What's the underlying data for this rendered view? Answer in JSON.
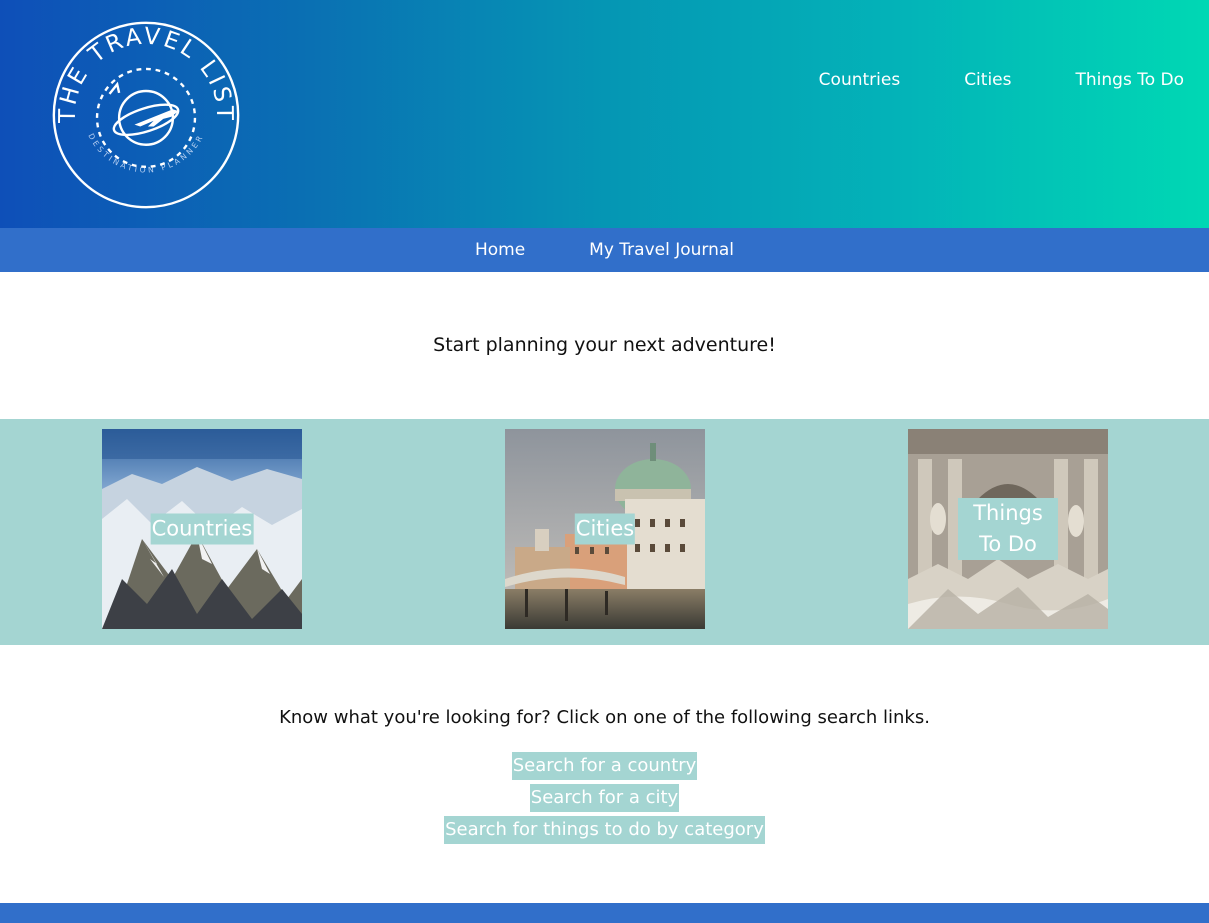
{
  "logo": {
    "top_text": "THE TRAVEL LIST",
    "bottom_text": "DESTINATION PLANNER"
  },
  "top_nav": [
    {
      "label": "Countries"
    },
    {
      "label": "Cities"
    },
    {
      "label": "Things To Do"
    }
  ],
  "sub_nav": [
    {
      "label": "Home"
    },
    {
      "label": "My Travel Journal"
    }
  ],
  "tagline": "Start planning your next adventure!",
  "tiles": [
    {
      "label": "Countries",
      "image": "mountain-photo"
    },
    {
      "label": "Cities",
      "image": "venice-photo"
    },
    {
      "label": "Things To Do",
      "image": "fountain-photo"
    }
  ],
  "search": {
    "intro": "Know what you're looking for? Click on one of the following search links.",
    "links": [
      {
        "label": "Search for a country"
      },
      {
        "label": "Search for a city"
      },
      {
        "label": "Search for things to do by category"
      }
    ]
  },
  "colors": {
    "accent": "#316fca",
    "tile_bg": "#a4d5d2",
    "header_start": "#0e4fb8",
    "header_end": "#00d8b4"
  }
}
